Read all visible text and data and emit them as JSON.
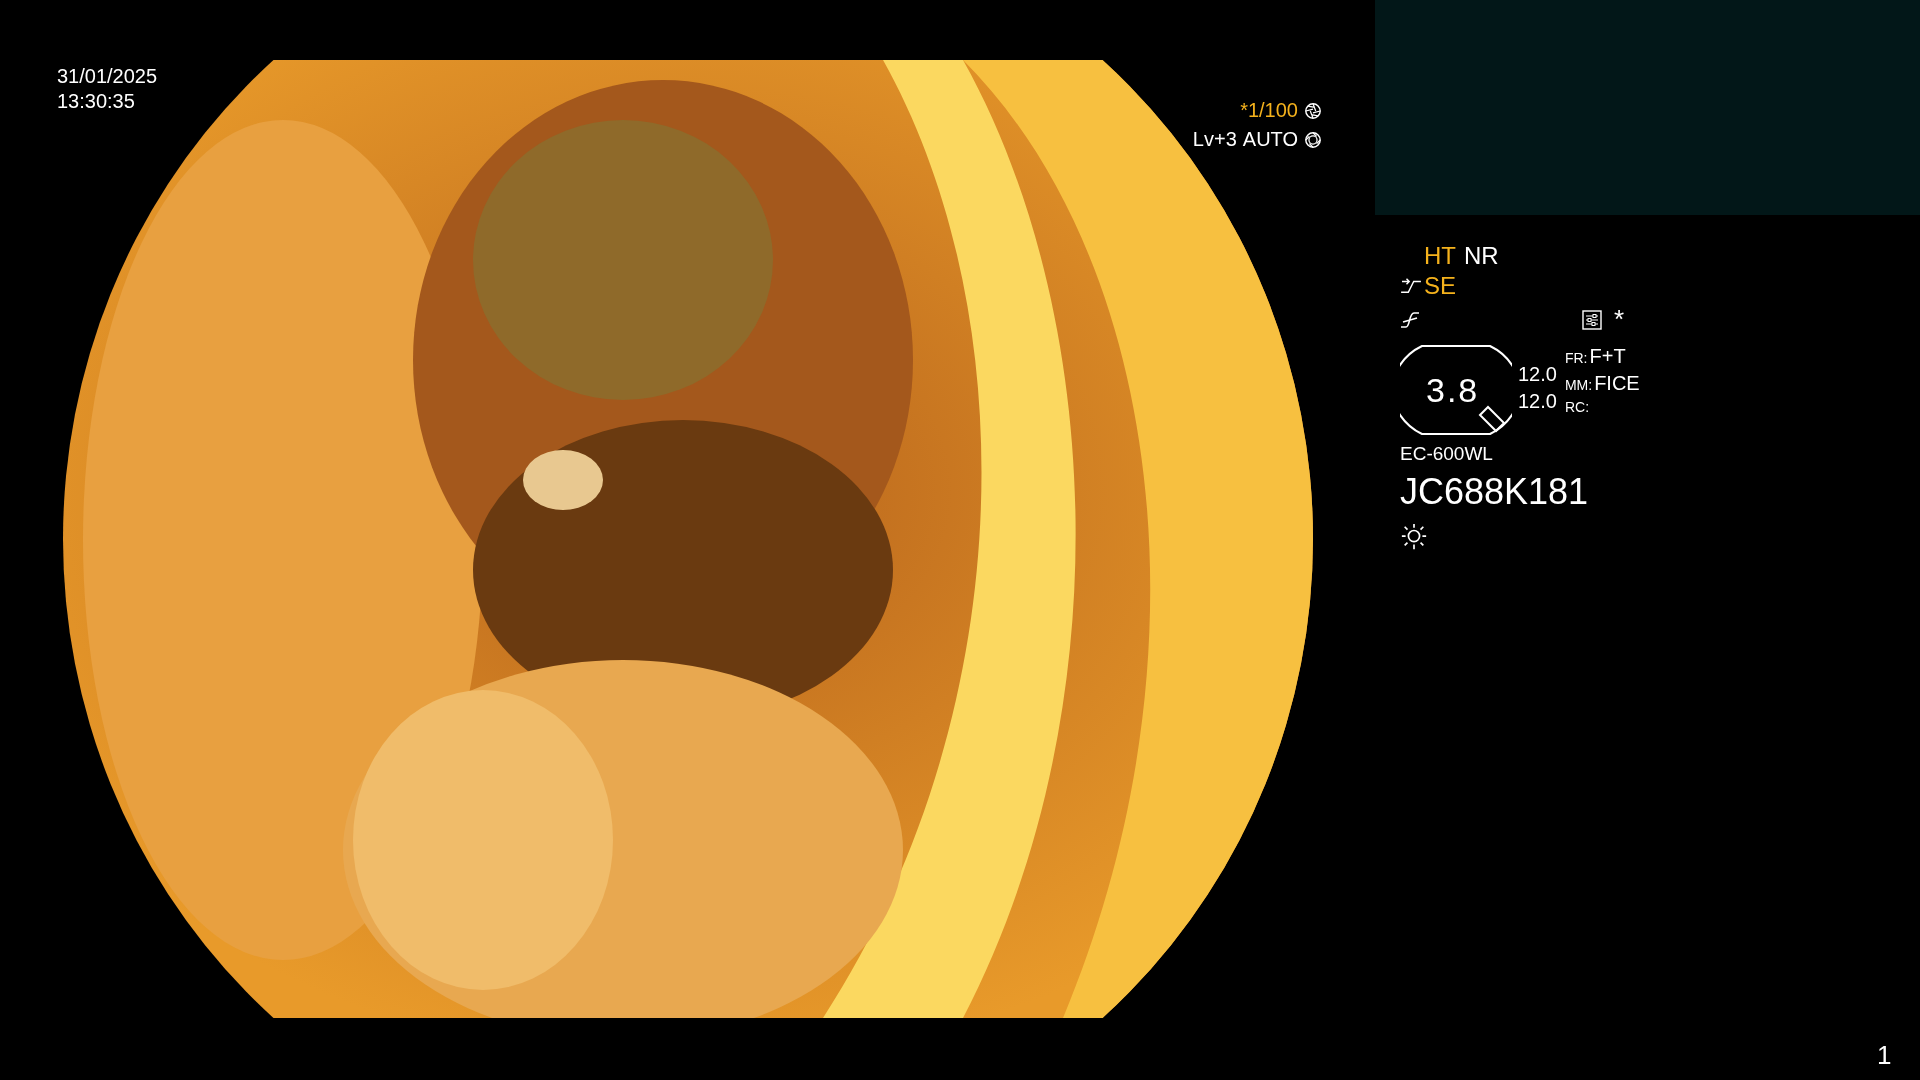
{
  "timestamp": {
    "date": "31/01/2025",
    "time": "13:30:35"
  },
  "exposure": {
    "shutter": "*1/100",
    "shutter_active": true,
    "level": "Lv+3",
    "mode": "AUTO"
  },
  "status": {
    "ht": {
      "label": "HT",
      "active": true
    },
    "nr": {
      "label": "NR",
      "active": false
    },
    "se": {
      "label": "SE",
      "active": true
    },
    "asterisk": "*"
  },
  "zoom": {
    "value": "3.8",
    "reading_1": "12.0",
    "reading_2": "12.0"
  },
  "settings": [
    {
      "label": "FR:",
      "value": "F+T"
    },
    {
      "label": "MM:",
      "value": "FICE"
    },
    {
      "label": "RC:"
    }
  ],
  "scope": {
    "model": "EC-600WL",
    "serial": "JC688K181"
  },
  "page_number": "1"
}
